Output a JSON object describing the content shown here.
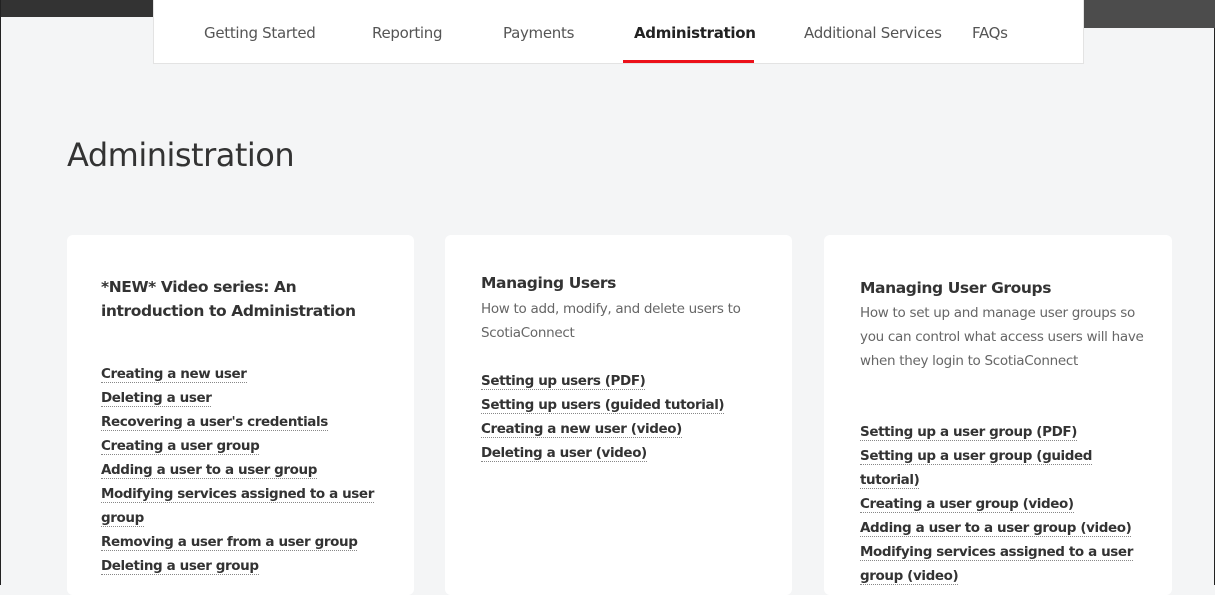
{
  "nav": {
    "tabs": [
      {
        "label": "Getting Started"
      },
      {
        "label": "Reporting"
      },
      {
        "label": "Payments"
      },
      {
        "label": "Administration"
      },
      {
        "label": "Additional Services"
      },
      {
        "label": "FAQs"
      }
    ],
    "active_tab": "Administration"
  },
  "page": {
    "title": "Administration"
  },
  "cards": [
    {
      "title": "*NEW*  Video series: An introduction to Administration",
      "description": "",
      "links": [
        "Creating a new user",
        "Deleting a user",
        "Recovering a user's credentials",
        "Creating a user group",
        "Adding a user to a user group",
        "Modifying services assigned to a user group",
        "Removing a user from a user group",
        "Deleting a user group"
      ]
    },
    {
      "title": "Managing Users",
      "description": "How to add, modify, and delete users to ScotiaConnect",
      "links": [
        "Setting up users (PDF)",
        "Setting up users (guided tutorial)",
        "Creating a new user (video)",
        "Deleting a user (video)"
      ]
    },
    {
      "title": "Managing User Groups",
      "description": "How to set up and manage user groups so you can control what access users will have when they login to ScotiaConnect",
      "links": [
        "Setting up a user group (PDF)",
        "Setting up a user group (guided tutorial)",
        "Creating a user group (video)",
        "Adding a user to a user group (video)",
        "Modifying services assigned to a user group (video)"
      ]
    }
  ],
  "colors": {
    "accent": "#ec111a",
    "page_background": "#f4f5f6",
    "card_background": "#ffffff",
    "text": "#333333"
  }
}
